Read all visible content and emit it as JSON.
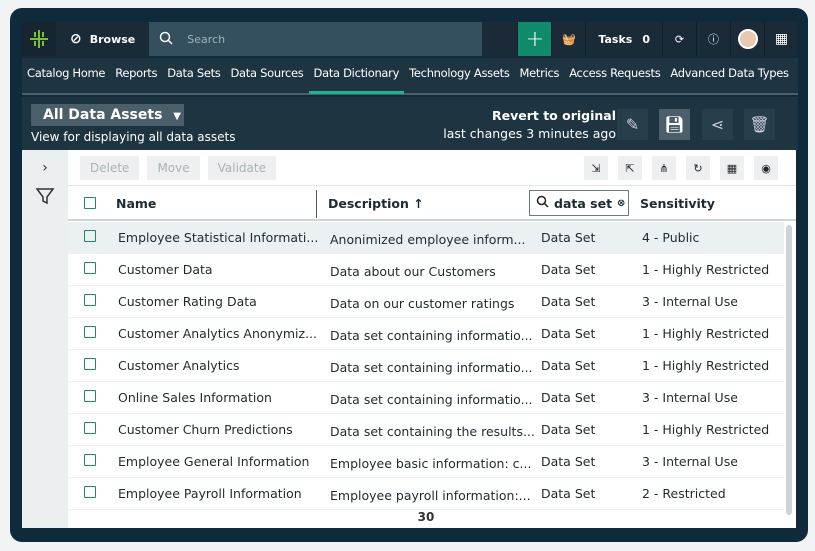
{
  "topbar": {
    "browse": "Browse",
    "search_placeholder": "Search",
    "tasks_label": "Tasks",
    "tasks_count": "0"
  },
  "nav": [
    "Catalog Home",
    "Reports",
    "Data Sets",
    "Data Sources",
    "Data Dictionary",
    "Technology Assets",
    "Metrics",
    "Access Requests",
    "Advanced Data Types"
  ],
  "view": {
    "title": "All Data Assets",
    "description": "View for displaying all data assets",
    "revert": "Revert to original",
    "last_changes": "last changes 3 minutes ago"
  },
  "actions": {
    "delete": "Delete",
    "move": "Move",
    "validate": "Validate"
  },
  "table": {
    "columns": {
      "name": "Name",
      "description": "Description",
      "sort": "↑",
      "filter_value": "data set",
      "sensitivity": "Sensitivity"
    },
    "rows": [
      {
        "name": "Employee Statistical Informati...",
        "description": "Anonimized employee inform...",
        "type": "Data Set",
        "sensitivity": "4 - Public"
      },
      {
        "name": "Customer Data",
        "description": "Data about our Customers",
        "type": "Data Set",
        "sensitivity": "1 - Highly Restricted"
      },
      {
        "name": "Customer Rating Data",
        "description": "Data on our customer ratings",
        "type": "Data Set",
        "sensitivity": "3 - Internal Use"
      },
      {
        "name": "Customer Analytics Anonymiz...",
        "description": "Data set containing informatio...",
        "type": "Data Set",
        "sensitivity": "1 - Highly Restricted"
      },
      {
        "name": "Customer Analytics",
        "description": "Data set containing informatio...",
        "type": "Data Set",
        "sensitivity": "1 - Highly Restricted"
      },
      {
        "name": "Online Sales Information",
        "description": "Data set containing informatio...",
        "type": "Data Set",
        "sensitivity": "3 - Internal Use"
      },
      {
        "name": "Customer Churn Predictions",
        "description": "Data set containing the results...",
        "type": "Data Set",
        "sensitivity": "1 - Highly Restricted"
      },
      {
        "name": "Employee General Information",
        "description": "Employee basic information: c...",
        "type": "Data Set",
        "sensitivity": "3 - Internal Use"
      },
      {
        "name": "Employee Payroll Information",
        "description": "Employee payroll information:...",
        "type": "Data Set",
        "sensitivity": "2 - Restricted"
      }
    ],
    "total": "30"
  }
}
